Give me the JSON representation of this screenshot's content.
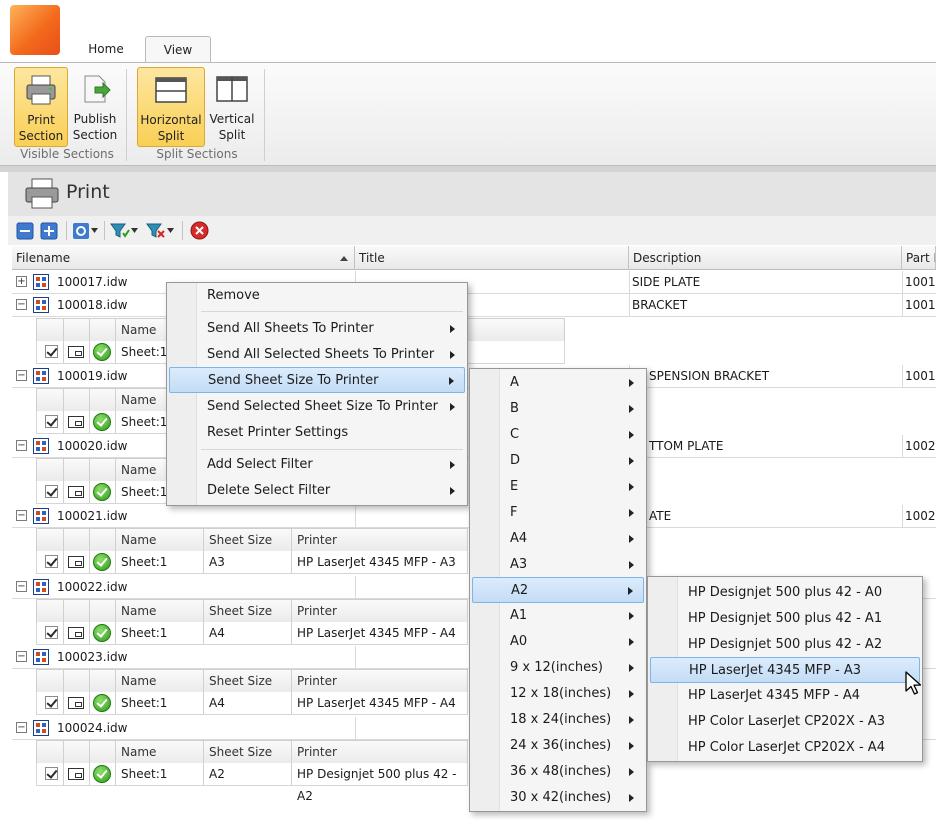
{
  "ribbon": {
    "tabs": [
      "Home",
      "View"
    ],
    "active_tab": "View",
    "groups": [
      {
        "label": "Visible Sections",
        "buttons": [
          {
            "label1": "Print",
            "label2": "Section",
            "active": true
          },
          {
            "label1": "Publish",
            "label2": "Section",
            "active": false
          }
        ]
      },
      {
        "label": "Split Sections",
        "buttons": [
          {
            "label1": "Horizontal",
            "label2": "Split",
            "active": true
          },
          {
            "label1": "Vertical",
            "label2": "Split",
            "active": false
          }
        ]
      }
    ]
  },
  "panel": {
    "title": "Print"
  },
  "grid": {
    "columns": {
      "filename": "Filename",
      "title": "Title",
      "description": "Description",
      "part": "Part N"
    },
    "sub_columns": {
      "name": "Name",
      "sheet_size": "Sheet Size",
      "printer": "Printer"
    },
    "files": [
      {
        "name": "100017.idw",
        "expander": "+",
        "description": "SIDE PLATE",
        "part": "1001"
      },
      {
        "name": "100018.idw",
        "expander": "−",
        "description": "BRACKET",
        "part": "1001",
        "sheet": {
          "name": "Sheet:1",
          "size": "",
          "printer": ""
        }
      },
      {
        "name": "100019.idw",
        "expander": "−",
        "description": "SPENSION BRACKET",
        "part": "1001",
        "sheet": {
          "name": "Sheet:1",
          "size": "",
          "printer": ""
        }
      },
      {
        "name": "100020.idw",
        "expander": "−",
        "description": "TTOM PLATE",
        "part": "1002",
        "sheet": {
          "name": "Sheet:1",
          "size": "",
          "printer": ""
        }
      },
      {
        "name": "100021.idw",
        "expander": "−",
        "description": "ATE",
        "part": "1002",
        "sheet": {
          "name": "Sheet:1",
          "size": "A3",
          "printer": "HP LaserJet 4345 MFP - A3"
        }
      },
      {
        "name": "100022.idw",
        "expander": "−",
        "description": "",
        "part": "",
        "sheet": {
          "name": "Sheet:1",
          "size": "A4",
          "printer": "HP LaserJet 4345 MFP - A4"
        }
      },
      {
        "name": "100023.idw",
        "expander": "−",
        "description": "",
        "part": "",
        "sheet": {
          "name": "Sheet:1",
          "size": "A4",
          "printer": "HP LaserJet 4345 MFP - A4"
        }
      },
      {
        "name": "100024.idw",
        "expander": "−",
        "description": "",
        "part": "",
        "sheet": {
          "name": "Sheet:1",
          "size": "A2",
          "printer": "HP Designjet 500 plus 42 - A2"
        }
      }
    ]
  },
  "context_menu": {
    "items": [
      {
        "label": "Remove",
        "submenu": false
      },
      {
        "label": "Send All Sheets To Printer",
        "submenu": true
      },
      {
        "label": "Send All Selected Sheets To Printer",
        "submenu": true
      },
      {
        "label": "Send Sheet Size To Printer",
        "submenu": true,
        "highlighted": true
      },
      {
        "label": "Send Selected Sheet Size To Printer",
        "submenu": true
      },
      {
        "label": "Reset Printer Settings",
        "submenu": false
      },
      {
        "label": "Add Select Filter",
        "submenu": true
      },
      {
        "label": "Delete Select Filter",
        "submenu": true
      }
    ]
  },
  "size_menu": {
    "items": [
      "A",
      "B",
      "C",
      "D",
      "E",
      "F",
      "A4",
      "A3",
      "A2",
      "A1",
      "A0",
      "9 x 12(inches)",
      "12 x 18(inches)",
      "18 x 24(inches)",
      "24 x 36(inches)",
      "36 x 48(inches)",
      "30 x 42(inches)"
    ],
    "highlighted": "A2"
  },
  "printer_menu": {
    "items": [
      "HP Designjet 500 plus 42 - A0",
      "HP Designjet 500 plus 42 - A1",
      "HP Designjet 500 plus 42 - A2",
      "HP LaserJet 4345 MFP - A3",
      "HP LaserJet 4345 MFP - A4",
      "HP Color LaserJet CP202X - A3",
      "HP Color LaserJet CP202X - A4"
    ],
    "highlighted": "HP LaserJet 4345 MFP - A3"
  },
  "colors": {
    "accent": "#f9cf55",
    "menu_highlight": "#c3dcf6",
    "orb": "#f36a1c"
  }
}
